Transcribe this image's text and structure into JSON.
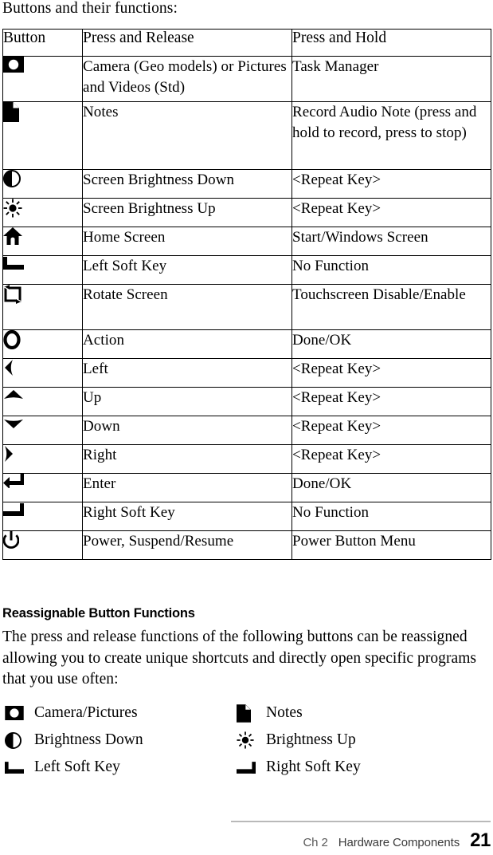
{
  "intro_text": "Buttons and their functions:",
  "table": {
    "headers": [
      "Button",
      "Press and Release",
      "Press and Hold"
    ],
    "rows": [
      {
        "icon": "camera-icon",
        "press_and_release": "Camera (Geo models) or Pictures and Videos (Std)",
        "press_and_hold": "Task Manager"
      },
      {
        "icon": "notes-page-icon",
        "press_and_release": "Notes",
        "press_and_hold": "Record Audio Note (press and hold to record, press to stop)"
      },
      {
        "icon": "brightness-down-icon",
        "press_and_release": "Screen Brightness Down",
        "press_and_hold": "<Repeat Key>"
      },
      {
        "icon": "brightness-up-icon",
        "press_and_release": "Screen Brightness Up",
        "press_and_hold": "<Repeat Key>"
      },
      {
        "icon": "home-icon",
        "press_and_release": "Home Screen",
        "press_and_hold": "Start/Windows Screen"
      },
      {
        "icon": "left-soft-key-icon",
        "press_and_release": "Left Soft Key",
        "press_and_hold": "No Function"
      },
      {
        "icon": "rotate-screen-icon",
        "press_and_release": "Rotate Screen",
        "press_and_hold": "Touchscreen Disable/Enable"
      },
      {
        "icon": "action-ring-icon",
        "press_and_release": "Action",
        "press_and_hold": "Done/OK"
      },
      {
        "icon": "arrow-left-icon",
        "press_and_release": "Left",
        "press_and_hold": "<Repeat Key>"
      },
      {
        "icon": "arrow-up-icon",
        "press_and_release": "Up",
        "press_and_hold": "<Repeat Key>"
      },
      {
        "icon": "arrow-down-icon",
        "press_and_release": "Down",
        "press_and_hold": "<Repeat Key>"
      },
      {
        "icon": "arrow-right-icon",
        "press_and_release": "Right",
        "press_and_hold": "<Repeat Key>"
      },
      {
        "icon": "enter-return-icon",
        "press_and_release": "Enter",
        "press_and_hold": "Done/OK"
      },
      {
        "icon": "right-soft-key-icon",
        "press_and_release": "Right Soft Key",
        "press_and_hold": "No Function"
      },
      {
        "icon": "power-icon",
        "press_and_release": "Power, Suspend/Resume",
        "press_and_hold": "Power Button Menu"
      }
    ]
  },
  "section": {
    "heading": "Reassignable Button Functions",
    "paragraph": "The press and release functions of the following buttons can be reassigned allowing you to create unique shortcuts and directly open specific programs that you use often:"
  },
  "reassignable": {
    "rows": [
      {
        "left": {
          "icon": "camera-icon",
          "label": "Camera/Pictures"
        },
        "right": {
          "icon": "notes-page-icon",
          "label": "Notes"
        }
      },
      {
        "left": {
          "icon": "brightness-down-icon",
          "label": "Brightness Down"
        },
        "right": {
          "icon": "brightness-up-icon",
          "label": "Brightness Up"
        }
      },
      {
        "left": {
          "icon": "left-soft-key-icon",
          "label": "Left Soft Key"
        },
        "right": {
          "icon": "right-soft-key-icon",
          "label": "Right Soft Key"
        }
      }
    ]
  },
  "footer": {
    "chapter": "Ch 2",
    "section_name": "Hardware Components",
    "page_number": "21",
    "rule_color": "#b9b9b9"
  }
}
